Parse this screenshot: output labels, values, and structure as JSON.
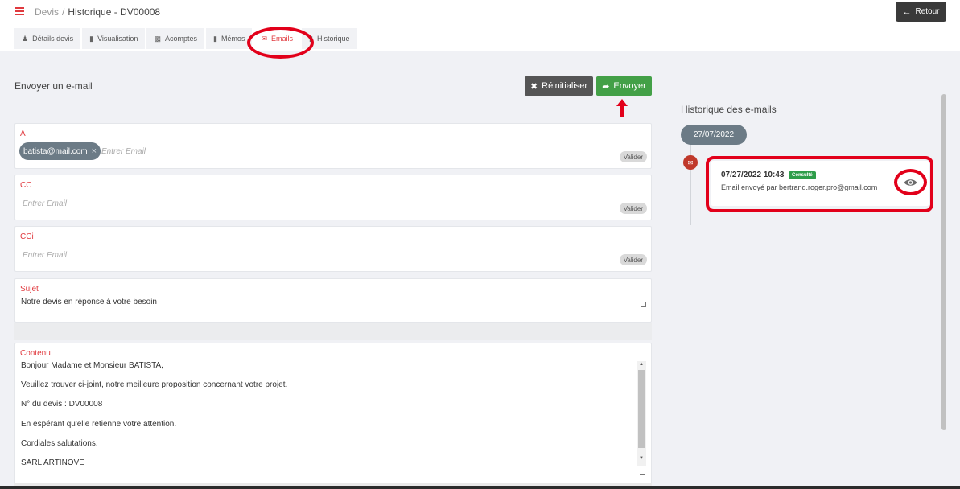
{
  "header": {
    "breadcrumb_root": "Devis",
    "breadcrumb_sep": "/",
    "breadcrumb_current": "Historique - DV00008",
    "back_label": "Retour"
  },
  "tabs": [
    {
      "label": "Détails devis",
      "icon": "user-icon"
    },
    {
      "label": "Visualisation",
      "icon": "file-icon"
    },
    {
      "label": "Acomptes",
      "icon": "money-icon"
    },
    {
      "label": "Mémos",
      "icon": "file-icon"
    },
    {
      "label": "Emails",
      "icon": "envelope-icon",
      "active": true
    },
    {
      "label": "Historique",
      "icon": "file-icon"
    }
  ],
  "form": {
    "title": "Envoyer un e-mail",
    "reset_label": "Réinitialiser",
    "send_label": "Envoyer",
    "to": {
      "label": "A",
      "chips": [
        "batista@mail.com"
      ],
      "placeholder": "Entrer Email",
      "validate_label": "Valider"
    },
    "cc": {
      "label": "CC",
      "placeholder": "Entrer Email",
      "validate_label": "Valider"
    },
    "bcc": {
      "label": "CCi",
      "placeholder": "Entrer Email",
      "validate_label": "Valider"
    },
    "subject": {
      "label": "Sujet",
      "value": "Notre devis en réponse à votre besoin"
    },
    "content": {
      "label": "Contenu",
      "lines": [
        "Bonjour Madame et Monsieur BATISTA,",
        "Veuillez trouver ci-joint, notre meilleure proposition concernant votre projet.",
        "N° du devis :  DV00008",
        "En espérant qu'elle retienne votre attention.",
        "Cordiales salutations.",
        "SARL ARTINOVE"
      ]
    }
  },
  "history": {
    "title": "Historique des e-mails",
    "date_group": "27/07/2022",
    "entries": [
      {
        "datetime": "07/27/2022 10:43",
        "status": "Consulté",
        "description": "Email envoyé par bertrand.roger.pro@gmail.com"
      }
    ]
  },
  "colors": {
    "accent": "#e0393e",
    "send_button": "#43a047",
    "reset_button": "#555555",
    "chip": "#6c7b86",
    "badge": "#2e9d4a",
    "annotation": "#e2001a"
  }
}
